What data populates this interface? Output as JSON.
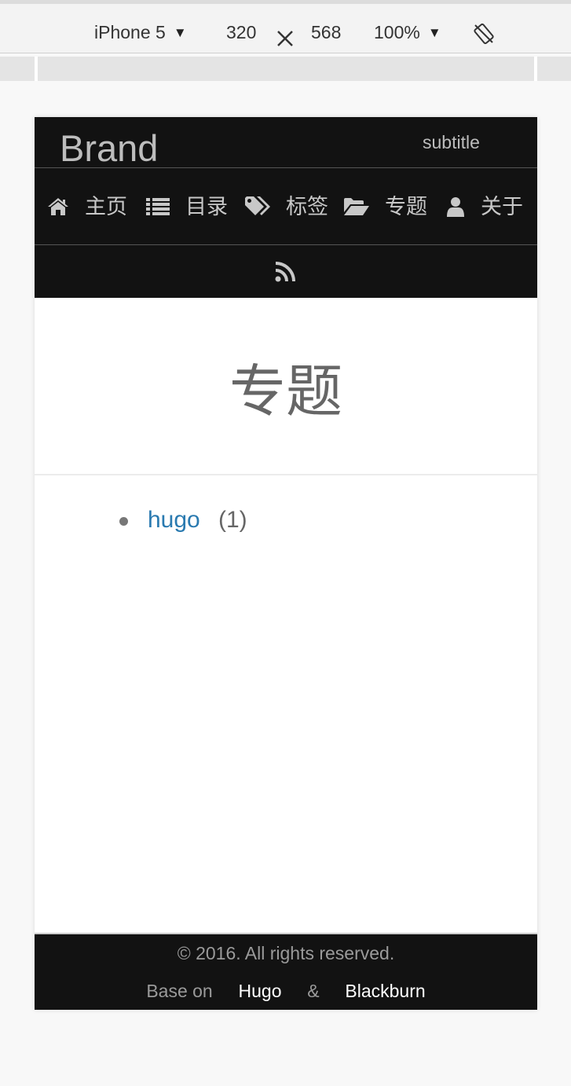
{
  "devtools": {
    "device": "iPhone 5",
    "width": "320",
    "height": "568",
    "zoom": "100%",
    "dropdown_arrow": "▼",
    "times_glyph": "⨯"
  },
  "header": {
    "brand": "Brand",
    "subtitle": "subtitle",
    "nav": [
      {
        "label": "主页",
        "icon": "home-icon"
      },
      {
        "label": "目录",
        "icon": "list-icon"
      },
      {
        "label": "标签",
        "icon": "tags-icon"
      },
      {
        "label": "专题",
        "icon": "folder-open-icon"
      },
      {
        "label": "关于",
        "icon": "user-icon"
      }
    ],
    "rss_icon": "rss-icon"
  },
  "main": {
    "title": "专题",
    "series": [
      {
        "name": "hugo",
        "count": "(1)"
      }
    ]
  },
  "footer": {
    "copyright": "© 2016. All rights reserved.",
    "base_on": "Base on",
    "hugo": "Hugo",
    "amp": "&",
    "blackburn": "Blackburn"
  },
  "colors": {
    "header_bg": "#121212",
    "link": "#2a7ab0",
    "nav_text": "#c8c8c8"
  }
}
